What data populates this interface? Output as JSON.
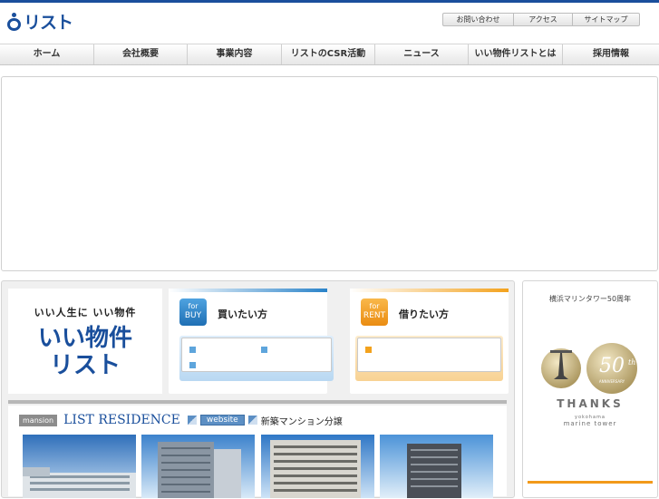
{
  "logo": {
    "text": "リスト"
  },
  "utility_nav": [
    {
      "label": "お問い合わせ"
    },
    {
      "label": "アクセス"
    },
    {
      "label": "サイトマップ"
    }
  ],
  "global_nav": [
    {
      "label": "ホーム"
    },
    {
      "label": "会社概要"
    },
    {
      "label": "事業内容"
    },
    {
      "label": "リストのCSR活動"
    },
    {
      "label": "ニュース"
    },
    {
      "label": "いい物件リストとは"
    },
    {
      "label": "採用情報"
    }
  ],
  "brand_block": {
    "tagline": "いい人生に いい物件",
    "name_line1": "いい物件",
    "name_line2": "リスト"
  },
  "buy_card": {
    "badge_top": "for",
    "badge_bottom": "BUY",
    "title": "買いたい方",
    "accent": "#2a83c9"
  },
  "rent_card": {
    "badge_top": "for",
    "badge_bottom": "RENT",
    "title": "借りたい方",
    "accent": "#f3a21d"
  },
  "residence": {
    "category": "mansion",
    "title": "LIST RESIDENCE",
    "website": "website",
    "subtitle": "新築マンション分譲"
  },
  "sidebar": {
    "title": "横浜マリンタワー50周年",
    "anniv_number": "50",
    "anniv_suffix": "th",
    "anniv_word": "ANNIVERSARY",
    "thanks": "THANKS",
    "sub_small": "yokohama",
    "sub": "marine tower"
  }
}
